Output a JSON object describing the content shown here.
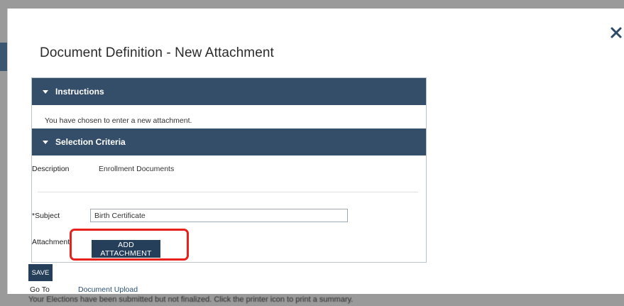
{
  "modal": {
    "title": "Document Definition - New Attachment",
    "close_label": "×"
  },
  "instructions": {
    "header": "Instructions",
    "text": "You have chosen to enter a new attachment."
  },
  "selection_criteria": {
    "header": "Selection Criteria",
    "description_label": "Description",
    "description_value": "Enrollment Documents",
    "subject_label": "*Subject",
    "subject_value": "Birth Certificate",
    "attachment_label": "Attachment",
    "add_attachment_label": "ADD ATTACHMENT"
  },
  "actions": {
    "save_label": "SAVE",
    "goto_label": "Go To",
    "goto_link": "Document Upload"
  },
  "backdrop": {
    "footer_text": "Your Elections have been submitted but not finalized. Click the printer icon to print a summary."
  },
  "colors": {
    "header_bg": "#344e6a",
    "button_bg": "#253f5b",
    "highlight": "#e8211d"
  },
  "icons": {
    "close": "close-icon",
    "collapse": "caret-down-icon"
  }
}
